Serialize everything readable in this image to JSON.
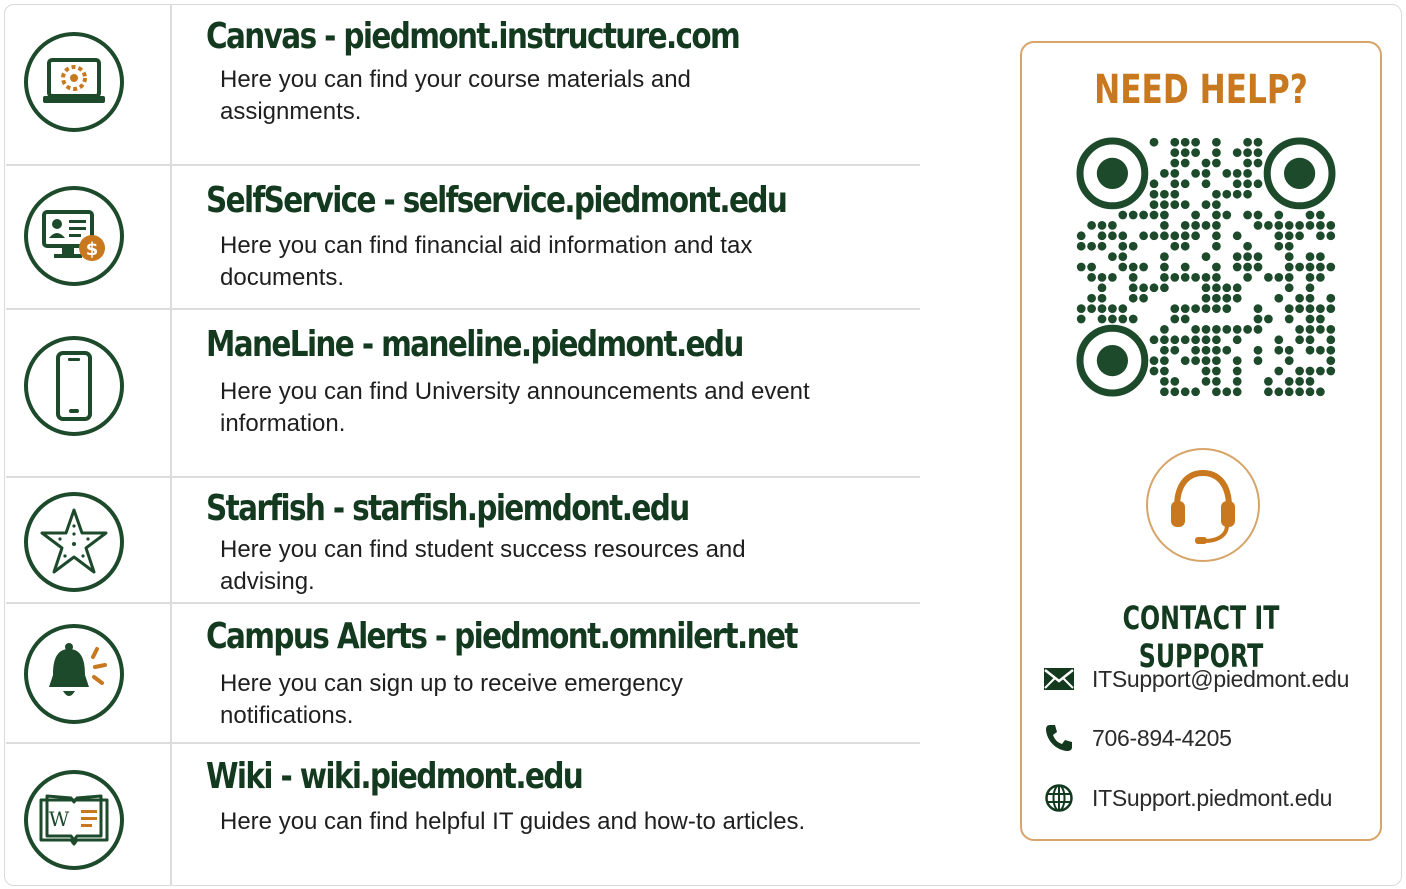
{
  "resources": [
    {
      "title": "Canvas - piedmont.instructure.com",
      "desc": "Here you can find your course materials and assignments.",
      "icon": "laptop-canvas-icon"
    },
    {
      "title": "SelfService - selfservice.piedmont.edu",
      "desc": "Here you can find financial aid information and tax documents.",
      "icon": "computer-dollar-icon"
    },
    {
      "title": "ManeLine - maneline.piedmont.edu",
      "desc": "Here you can find University announcements and event information.",
      "icon": "smartphone-icon"
    },
    {
      "title": "Starfish - starfish.piemdont.edu",
      "desc": "Here you can find student success resources and advising.",
      "icon": "starfish-icon"
    },
    {
      "title": "Campus Alerts - piedmont.omnilert.net",
      "desc": "Here you can sign up to receive emergency notifications.",
      "icon": "alert-bell-icon"
    },
    {
      "title": "Wiki - wiki.piedmont.edu",
      "desc": "Here you can find helpful IT guides and how-to articles.",
      "icon": "open-book-icon"
    }
  ],
  "help": {
    "title": "NEED HELP?",
    "contact_title": "CONTACT IT SUPPORT",
    "email": "ITSupport@piedmont.edu",
    "phone": "706-894-4205",
    "website": "ITSupport.piedmont.edu"
  },
  "colors": {
    "green": "#1d4a2b",
    "orange": "#c8781f",
    "border": "#d7a46a"
  }
}
